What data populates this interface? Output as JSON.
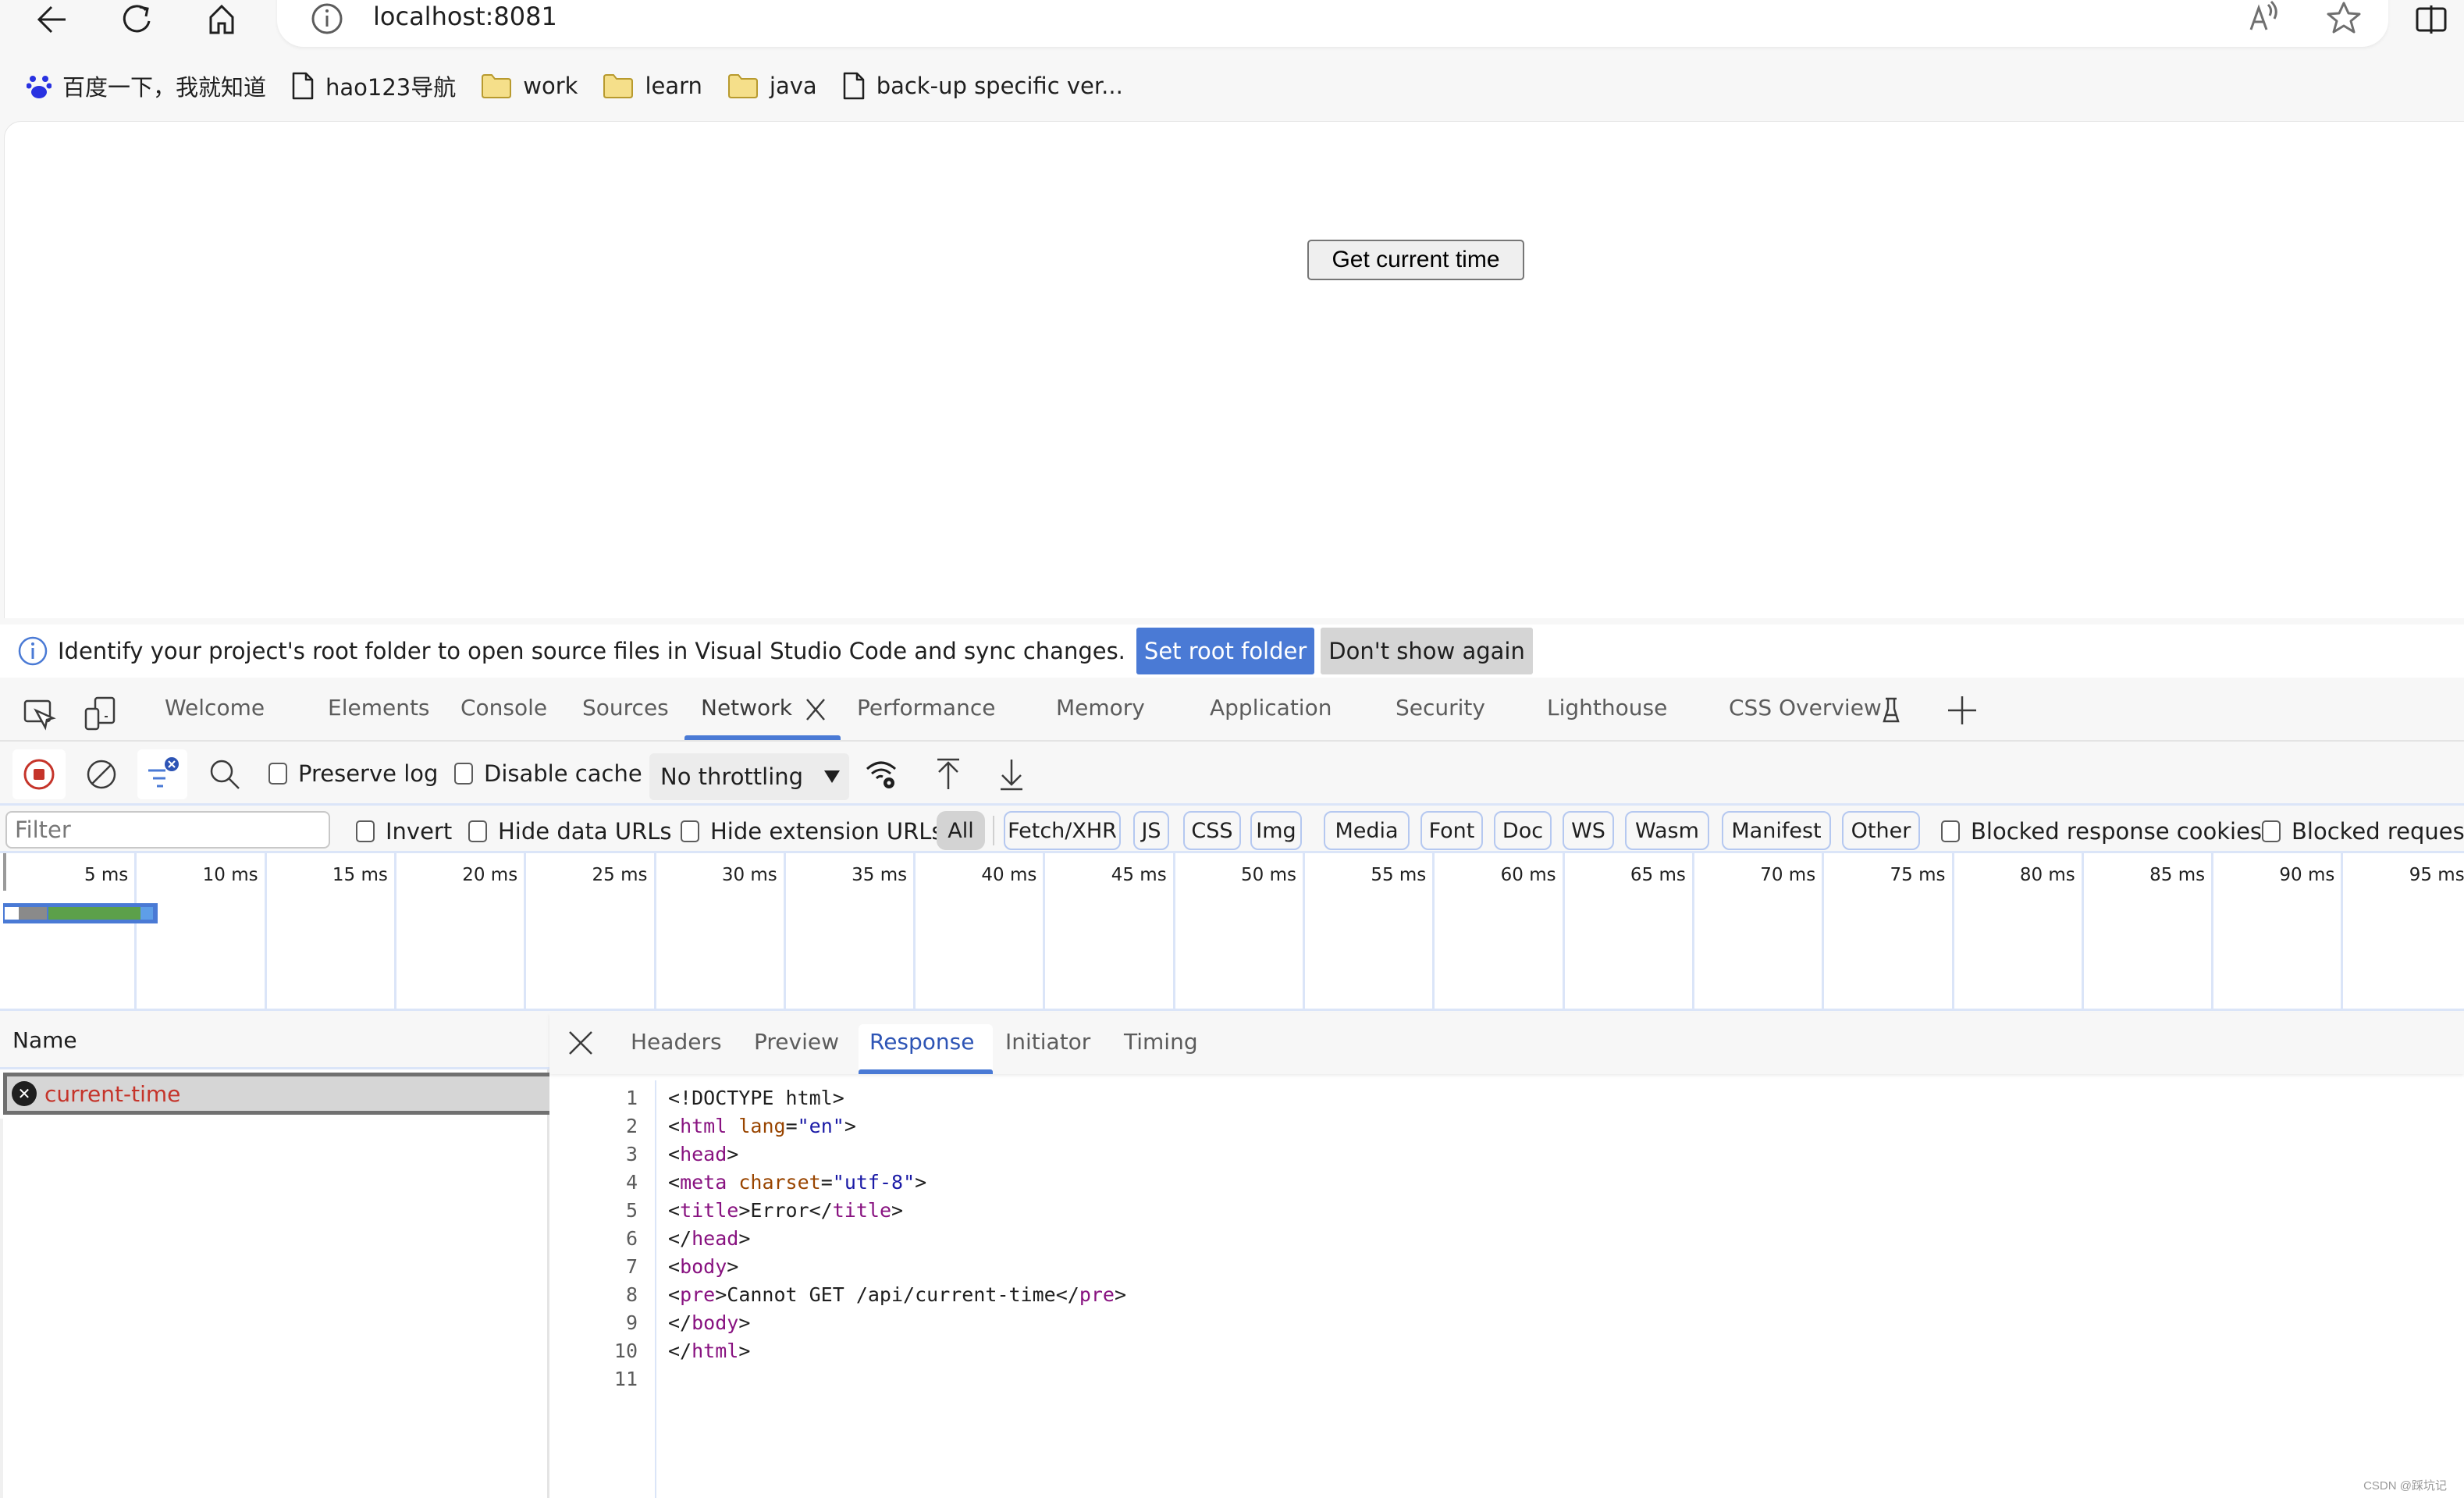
{
  "browser": {
    "url": "localhost:8081",
    "icons": [
      "back-icon",
      "reload-icon",
      "home-icon",
      "site-info-icon",
      "read-aloud-icon",
      "favorite-star-icon",
      "split-screen-icon"
    ]
  },
  "bookmarks": [
    {
      "label": "百度一下，我就知道",
      "icon": "baidu-paw-icon"
    },
    {
      "label": "hao123导航",
      "icon": "page-icon"
    },
    {
      "label": "work",
      "icon": "folder-icon"
    },
    {
      "label": "learn",
      "icon": "folder-icon"
    },
    {
      "label": "java",
      "icon": "folder-icon"
    },
    {
      "label": "back-up specific ver...",
      "icon": "page-icon"
    }
  ],
  "page": {
    "button_label": "Get current time"
  },
  "infobar": {
    "message": "Identify your project's root folder to open source files in Visual Studio Code and sync changes.",
    "primary_label": "Set root folder",
    "secondary_label": "Don't show again"
  },
  "devtools": {
    "tabs": [
      {
        "label": "Welcome"
      },
      {
        "label": "Elements"
      },
      {
        "label": "Console"
      },
      {
        "label": "Sources"
      },
      {
        "label": "Network",
        "active": true,
        "closable": true
      },
      {
        "label": "Performance"
      },
      {
        "label": "Memory"
      },
      {
        "label": "Application"
      },
      {
        "label": "Security"
      },
      {
        "label": "Lighthouse"
      },
      {
        "label": "CSS Overview",
        "experimental": true
      }
    ],
    "accent": "#4a7ad5"
  },
  "network": {
    "toolbar": {
      "preserve_log": {
        "label": "Preserve log",
        "checked": false
      },
      "disable_cache": {
        "label": "Disable cache",
        "checked": false
      },
      "throttling": "No throttling"
    },
    "filter": {
      "placeholder": "Filter",
      "value": "",
      "invert": {
        "label": "Invert",
        "checked": false
      },
      "hide_data_urls": {
        "label": "Hide data URLs",
        "checked": false
      },
      "hide_extension_urls": {
        "label": "Hide extension URLs",
        "checked": false
      },
      "types": [
        "All",
        "Fetch/XHR",
        "JS",
        "CSS",
        "Img",
        "Media",
        "Font",
        "Doc",
        "WS",
        "Wasm",
        "Manifest",
        "Other"
      ],
      "active_type": "All",
      "blocked_response_cookies": {
        "label": "Blocked response cookies",
        "checked": false
      },
      "blocked_requests": {
        "label": "Blocked requests",
        "checked": false
      }
    },
    "timeline": {
      "ticks": [
        "5 ms",
        "10 ms",
        "15 ms",
        "20 ms",
        "25 ms",
        "30 ms",
        "35 ms",
        "40 ms",
        "45 ms",
        "50 ms",
        "55 ms",
        "60 ms",
        "65 ms",
        "70 ms",
        "75 ms",
        "80 ms",
        "85 ms",
        "90 ms",
        "95 ms"
      ]
    },
    "requests_header": "Name",
    "requests": [
      {
        "name": "current-time",
        "status": "error"
      }
    ],
    "detail": {
      "tabs": [
        "Headers",
        "Preview",
        "Response",
        "Initiator",
        "Timing"
      ],
      "active_tab": "Response",
      "response_lines": [
        [
          [
            "punc",
            "<!DOCTYPE html>"
          ]
        ],
        [
          [
            "punc",
            "<"
          ],
          [
            "tag",
            "html"
          ],
          [
            "punc",
            " "
          ],
          [
            "attr",
            "lang"
          ],
          [
            "punc",
            "="
          ],
          [
            "val",
            "\"en\""
          ],
          [
            "punc",
            ">"
          ]
        ],
        [
          [
            "punc",
            "<"
          ],
          [
            "tag",
            "head"
          ],
          [
            "punc",
            ">"
          ]
        ],
        [
          [
            "punc",
            "<"
          ],
          [
            "tag",
            "meta"
          ],
          [
            "punc",
            " "
          ],
          [
            "attr",
            "charset"
          ],
          [
            "punc",
            "="
          ],
          [
            "val",
            "\"utf-8\""
          ],
          [
            "punc",
            ">"
          ]
        ],
        [
          [
            "punc",
            "<"
          ],
          [
            "tag",
            "title"
          ],
          [
            "punc",
            ">Error</"
          ],
          [
            "tag",
            "title"
          ],
          [
            "punc",
            ">"
          ]
        ],
        [
          [
            "punc",
            "</"
          ],
          [
            "tag",
            "head"
          ],
          [
            "punc",
            ">"
          ]
        ],
        [
          [
            "punc",
            "<"
          ],
          [
            "tag",
            "body"
          ],
          [
            "punc",
            ">"
          ]
        ],
        [
          [
            "punc",
            "<"
          ],
          [
            "tag",
            "pre"
          ],
          [
            "punc",
            ">Cannot GET /api/current-time</"
          ],
          [
            "tag",
            "pre"
          ],
          [
            "punc",
            ">"
          ]
        ],
        [
          [
            "punc",
            "</"
          ],
          [
            "tag",
            "body"
          ],
          [
            "punc",
            ">"
          ]
        ],
        [
          [
            "punc",
            "</"
          ],
          [
            "tag",
            "html"
          ],
          [
            "punc",
            ">"
          ]
        ],
        []
      ]
    }
  },
  "watermark": "CSDN @踩坑记"
}
